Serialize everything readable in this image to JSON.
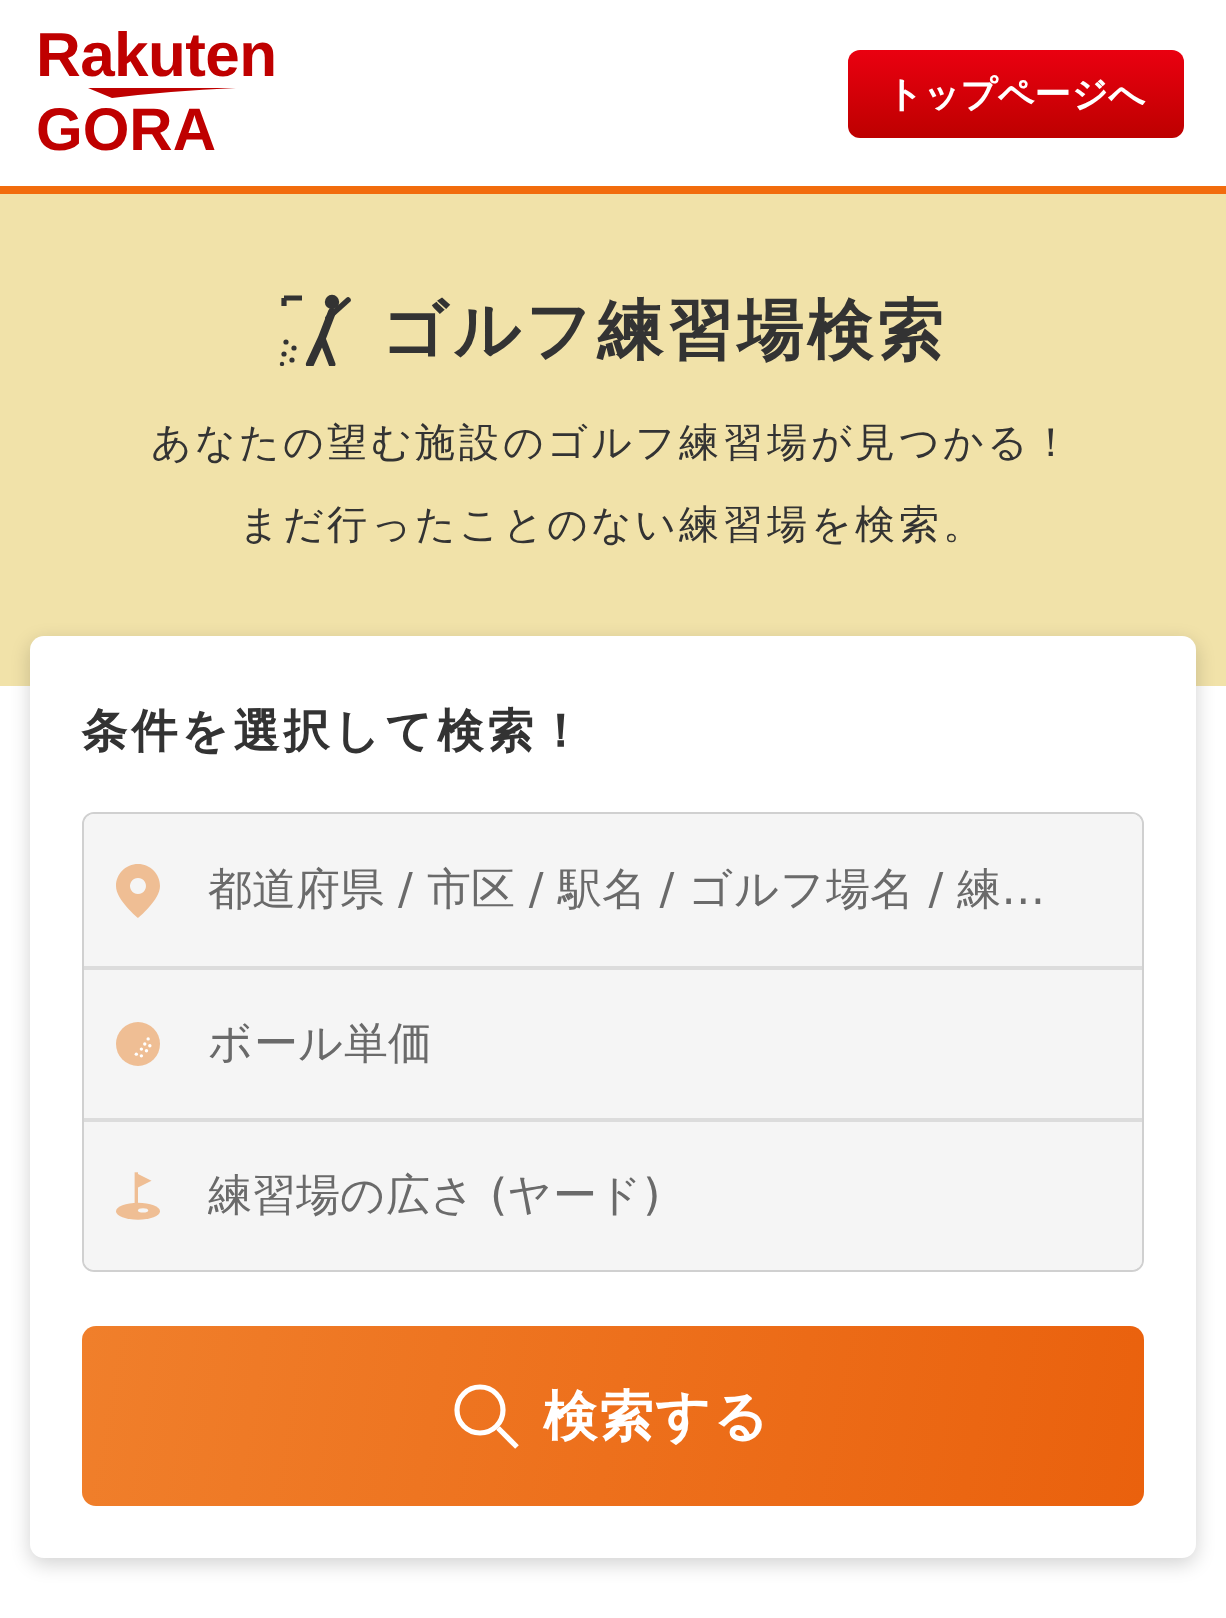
{
  "header": {
    "logo": {
      "brand": "Rakuten",
      "product": "GORA"
    },
    "top_page_button": "トップページへ"
  },
  "hero": {
    "title": "ゴルフ練習場検索",
    "description": [
      "あなたの望む施設のゴルフ練習場が見つかる！",
      "まだ行ったことのない練習場を検索。"
    ]
  },
  "search_panel": {
    "heading": "条件を選択して検索！",
    "fields": [
      {
        "kind": "location",
        "placeholder": "都道府県 / 市区 / 駅名 / ゴルフ場名 / 練…"
      },
      {
        "kind": "ball_price",
        "placeholder": "ボール単価"
      },
      {
        "kind": "range_size",
        "placeholder": "練習場の広さ (ヤード)"
      }
    ],
    "search_button": "検索する"
  }
}
